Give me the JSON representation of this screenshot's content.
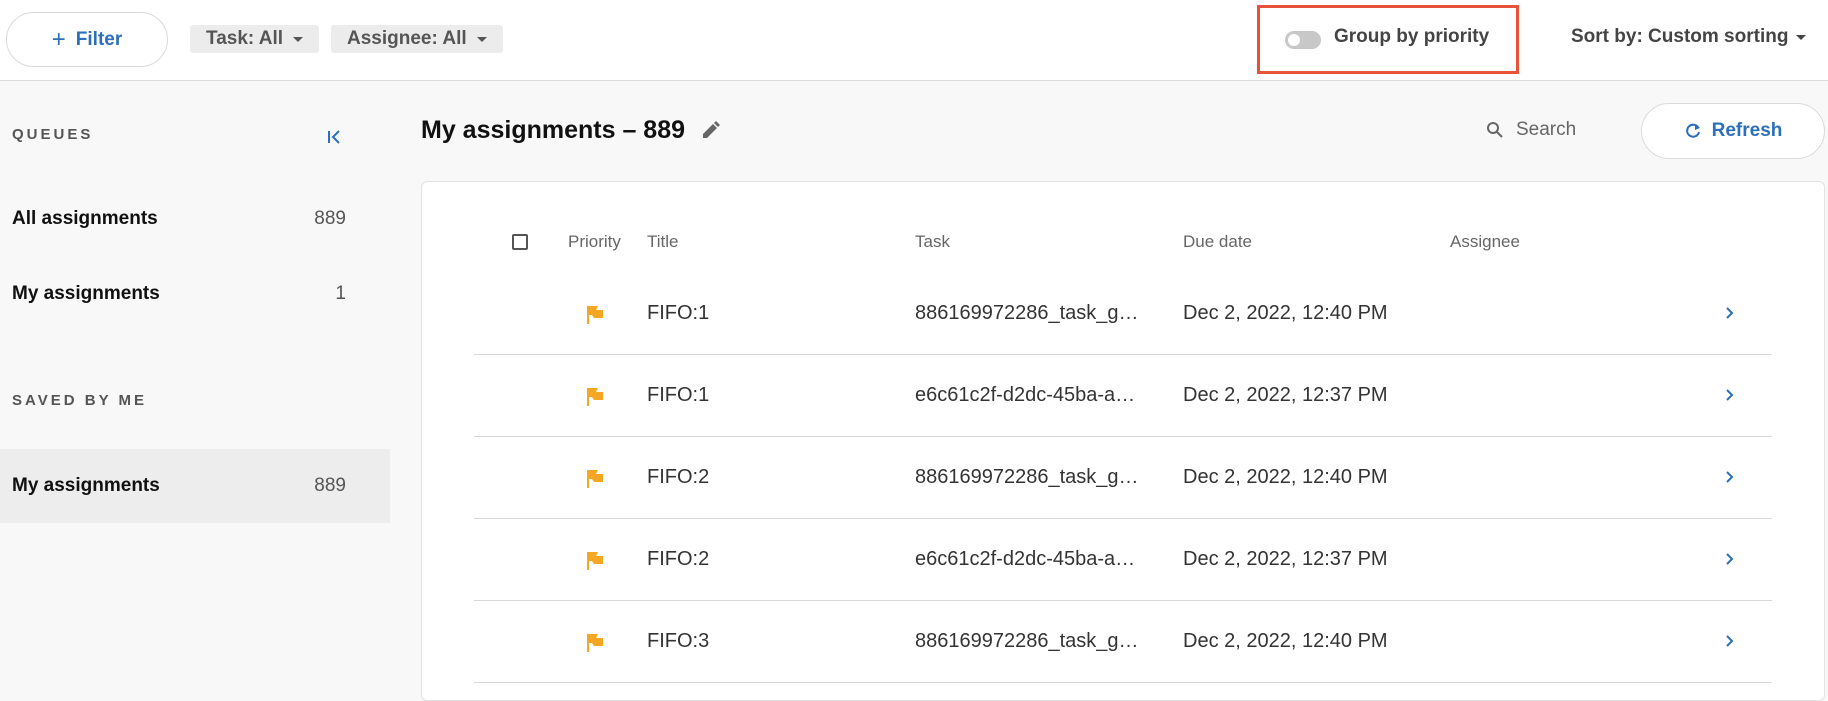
{
  "topbar": {
    "filter_label": "Filter",
    "chip_task": "Task: All",
    "chip_assignee": "Assignee: All",
    "group_by_label": "Group by priority",
    "group_by_on": false,
    "sort_label": "Sort by: Custom sorting"
  },
  "sidebar": {
    "queues_title": "QUEUES",
    "saved_title": "SAVED BY ME",
    "queues": [
      {
        "label": "All assignments",
        "count": "889"
      },
      {
        "label": "My assignments",
        "count": "1"
      }
    ],
    "saved": [
      {
        "label": "My assignments",
        "count": "889",
        "active": true
      }
    ]
  },
  "main": {
    "title": "My assignments – 889",
    "search_placeholder": "Search",
    "refresh_label": "Refresh"
  },
  "table": {
    "columns": [
      "Priority",
      "Title",
      "Task",
      "Due date",
      "Assignee"
    ],
    "rows": [
      {
        "title": "FIFO:1",
        "task": "886169972286_task_g…",
        "due": "Dec 2, 2022, 12:40 PM",
        "assignee": ""
      },
      {
        "title": "FIFO:1",
        "task": "e6c61c2f-d2dc-45ba-a…",
        "due": "Dec 2, 2022, 12:37 PM",
        "assignee": ""
      },
      {
        "title": "FIFO:2",
        "task": "886169972286_task_g…",
        "due": "Dec 2, 2022, 12:40 PM",
        "assignee": ""
      },
      {
        "title": "FIFO:2",
        "task": "e6c61c2f-d2dc-45ba-a…",
        "due": "Dec 2, 2022, 12:37 PM",
        "assignee": ""
      },
      {
        "title": "FIFO:3",
        "task": "886169972286_task_g…",
        "due": "Dec 2, 2022, 12:40 PM",
        "assignee": ""
      }
    ]
  },
  "colors": {
    "accent": "#2c6fba",
    "flag": "#f5a623",
    "highlight_box": "#e8523a"
  }
}
